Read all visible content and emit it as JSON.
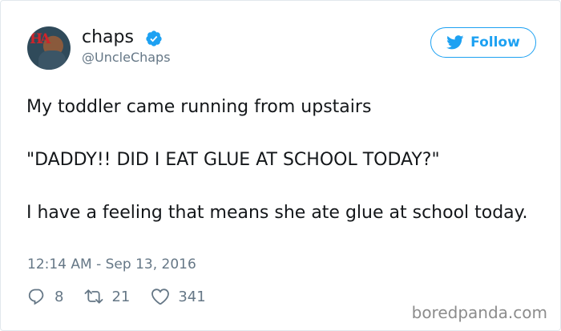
{
  "user": {
    "display_name": "chaps",
    "handle": "@UncleChaps",
    "verified": true,
    "avatar_icon": "avatar-image"
  },
  "follow_button": {
    "label": "Follow",
    "icon": "twitter-bird-icon"
  },
  "tweet": {
    "line1": "My toddler came running from upstairs",
    "line2": "\"DADDY!! DID I EAT GLUE AT SCHOOL TODAY?\"",
    "line3": "I have a feeling that means she ate glue at school today.",
    "timestamp": "12:14 AM - Sep 13, 2016"
  },
  "actions": {
    "replies": "8",
    "retweets": "21",
    "likes": "341"
  },
  "watermark": "boredpanda.com",
  "colors": {
    "accent": "#1da1f2",
    "text": "#14171a",
    "muted": "#657786"
  }
}
